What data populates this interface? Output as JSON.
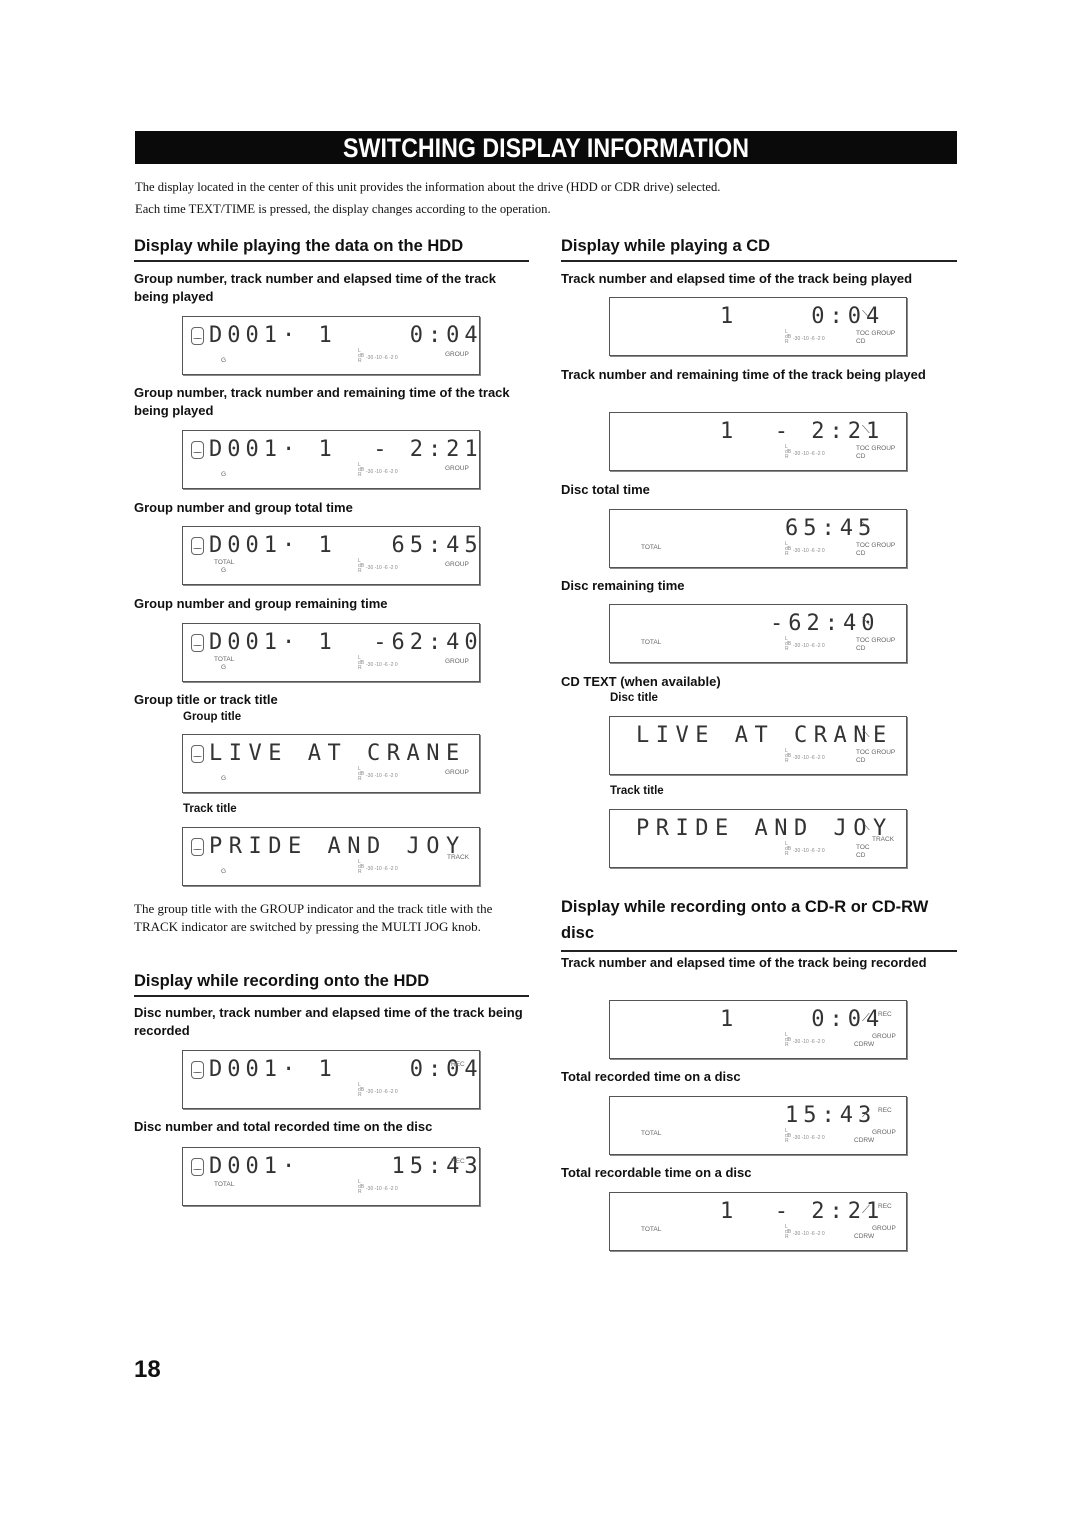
{
  "banner": "SWITCHING DISPLAY INFORMATION",
  "intro": [
    "The display located in the center of this unit provides the information about the drive (HDD or CDR drive) selected.",
    "Each time TEXT/TIME is pressed, the display changes according to the operation."
  ],
  "meter_scale": "-30 -10  -6  -2  0",
  "meter_lr": "L\ndB\nR",
  "left": {
    "hdd_play": {
      "heading": "Display while playing the data on the HDD",
      "items": [
        {
          "caption": "Group number, track number and elapsed time of the track being played",
          "display": "D001· 1    0:04",
          "sub": "G",
          "indicator": "GROUP"
        },
        {
          "caption": "Group number, track number and remaining time of the track being played",
          "display": "D001· 1  - 2:21",
          "sub": "G",
          "indicator": "GROUP"
        },
        {
          "caption": "Group number and group total time",
          "display": "D001· 1   65:45",
          "total": "TOTAL",
          "sub": "G",
          "indicator": "GROUP"
        },
        {
          "caption": "Group number and group remaining time",
          "display": "D001· 1  -62:40",
          "total": "TOTAL",
          "sub": "G",
          "indicator": "GROUP"
        }
      ],
      "title_section": {
        "caption": "Group title or track title",
        "group_title_label": "Group title",
        "group_title_display": "LIVE AT CRANE",
        "group_title_sub": "G",
        "group_title_indicator": "GROUP",
        "track_title_label": "Track title",
        "track_title_display": "PRIDE AND JOY",
        "track_title_sub": "G",
        "track_title_indicator": "TRACK"
      },
      "note": "The group title with the GROUP indicator and the track title with the TRACK indicator are switched by pressing the MULTI JOG knob."
    },
    "hdd_rec": {
      "heading": "Display while recording onto the HDD",
      "items": [
        {
          "caption": "Disc number, track number and elapsed time of the track being recorded",
          "display": "D001· 1    0:04",
          "indicator": "REC"
        },
        {
          "caption": "Disc number and total recorded time on the disc",
          "display": "D001·     15:43",
          "total": "TOTAL",
          "indicator": "REC"
        }
      ]
    }
  },
  "right": {
    "cd_play": {
      "heading": "Display while playing a CD",
      "items": [
        {
          "caption": "Track number and elapsed time of the track being played",
          "display": "1    0:04",
          "ind1": "TOC GROUP",
          "ind2": "CD"
        },
        {
          "caption": "Track number and remaining time of the track being played",
          "display": "1  - 2:21",
          "ind1": "TOC GROUP",
          "ind2": "CD"
        },
        {
          "caption": "Disc total time",
          "display": "65:45",
          "total": "TOTAL",
          "ind1": "TOC GROUP",
          "ind2": "CD"
        },
        {
          "caption": "Disc remaining time",
          "display": "-62:40",
          "total": "TOTAL",
          "ind1": "TOC GROUP",
          "ind2": "CD"
        }
      ],
      "cd_text": {
        "caption": "CD TEXT (when available)",
        "disc_title_label": "Disc title",
        "disc_title_display": "LIVE AT CRANE",
        "track_title_label": "Track title",
        "track_title_display": "PRIDE AND JOY",
        "track_indicator": "TRACK",
        "ind1": "TOC GROUP",
        "ind1_toc": "TOC",
        "ind2": "CD"
      }
    },
    "cd_rec": {
      "heading": "Display while recording onto a CD-R or CD-RW disc",
      "items": [
        {
          "caption": "Track number and elapsed time of the track being recorded",
          "display": "1    0:04",
          "indicator": "REC",
          "ind1": "GROUP",
          "ind2": "CDRW"
        },
        {
          "caption": "Total recorded time on a disc",
          "display": "15:43",
          "total": "TOTAL",
          "indicator": "REC",
          "ind1": "GROUP",
          "ind2": "CDRW"
        },
        {
          "caption": "Total recordable time on a disc",
          "display": "1  - 2:21",
          "total": "TOTAL",
          "indicator": "REC",
          "ind1": "GROUP",
          "ind2": "CDRW"
        }
      ]
    }
  },
  "page_number": "18"
}
